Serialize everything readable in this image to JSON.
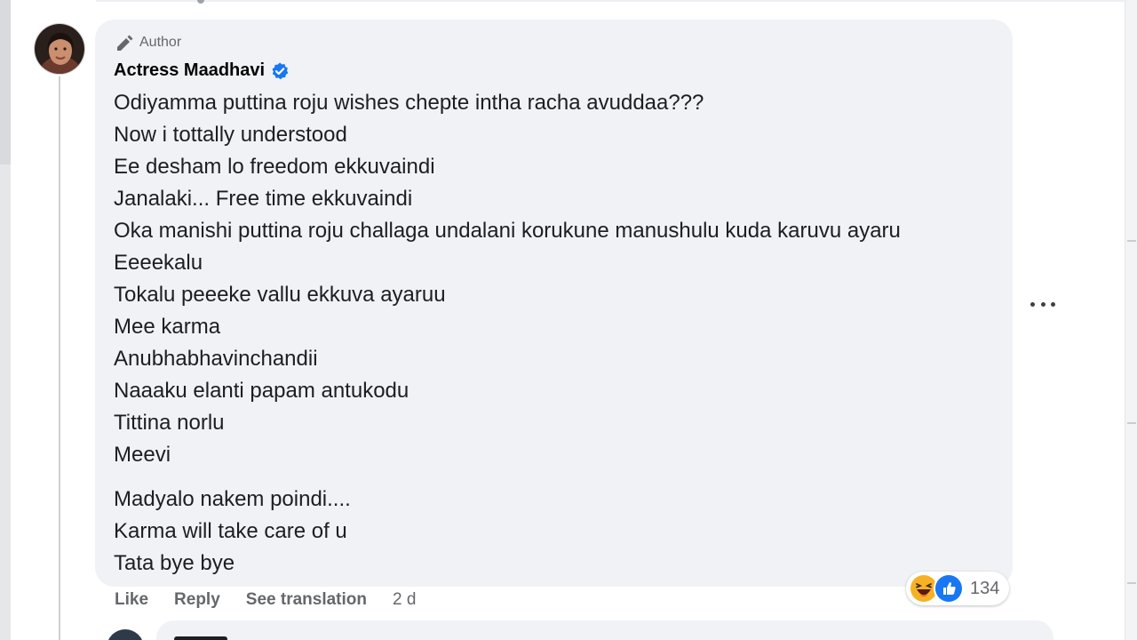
{
  "comment": {
    "author_tag": "Author",
    "author_name": "Actress Maadhavi",
    "lines_block1": [
      "Odiyamma puttina roju wishes chepte intha racha avuddaa???",
      "Now i tottally understood",
      "Ee desham lo freedom ekkuvaindi",
      "Janalaki... Free time ekkuvaindi",
      "Oka manishi puttina roju challaga undalani korukune manushulu kuda karuvu ayaru",
      "Eeeekalu",
      "Tokalu peeeke vallu ekkuva ayaruu",
      "Mee karma",
      "Anubhabhavinchandii",
      "Naaaku elanti papam antukodu",
      "Tittina norlu",
      "Meevi"
    ],
    "lines_block2": [
      "Madyalo nakem poindi....",
      "Karma will take care of u",
      "Tata bye bye"
    ]
  },
  "actions": {
    "like": "Like",
    "reply": "Reply",
    "see_translation": "See translation",
    "time": "2 d"
  },
  "reactions": {
    "icons": [
      "haha-icon",
      "like-icon"
    ],
    "count": "134"
  },
  "colors": {
    "bubble": "#f0f2f5",
    "verified": "#1877f2",
    "secondary_text": "#65676b"
  }
}
